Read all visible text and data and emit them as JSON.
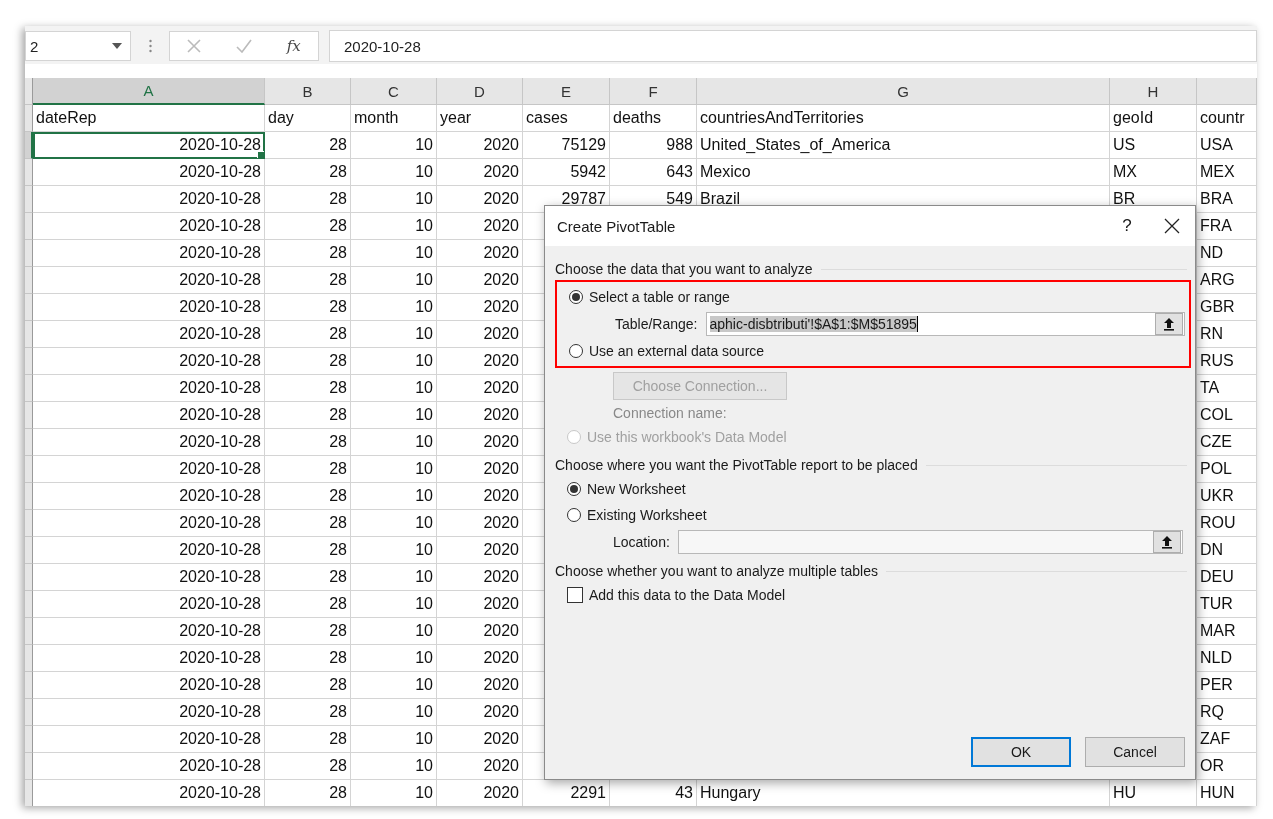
{
  "formula_bar": {
    "name_box": "2",
    "fx": "fx",
    "formula": "2020-10-28"
  },
  "sheet": {
    "columns": [
      {
        "label": "A",
        "selected": true
      },
      {
        "label": "B",
        "selected": false
      },
      {
        "label": "C",
        "selected": false
      },
      {
        "label": "D",
        "selected": false
      },
      {
        "label": "E",
        "selected": false
      },
      {
        "label": "F",
        "selected": false
      },
      {
        "label": "G",
        "selected": false
      },
      {
        "label": "H",
        "selected": false
      },
      {
        "selected": false
      }
    ],
    "rows": [
      {
        "kind": "header",
        "selected": false,
        "cells": {
          "A": "dateRep",
          "B": "day",
          "C": "month",
          "D": "year",
          "E": "cases",
          "F": "deaths",
          "G": "countriesAndTerritories",
          "H": "geoId",
          "I": "countr"
        }
      },
      {
        "kind": "data",
        "selected": true,
        "cells": {
          "A": "2020-10-28",
          "B": "28",
          "C": "10",
          "D": "2020",
          "E": "75129",
          "F": "988",
          "G": "United_States_of_America",
          "H": "US",
          "I": "USA"
        }
      },
      {
        "kind": "data",
        "selected": false,
        "cells": {
          "A": "2020-10-28",
          "B": "28",
          "C": "10",
          "D": "2020",
          "E": "5942",
          "F": "643",
          "G": "Mexico",
          "H": "MX",
          "I": "MEX"
        }
      },
      {
        "kind": "data",
        "selected": false,
        "cells": {
          "A": "2020-10-28",
          "B": "28",
          "C": "10",
          "D": "2020",
          "E": "29787",
          "F": "549",
          "G": "Brazil",
          "H": "BR",
          "I": "BRA"
        }
      },
      {
        "kind": "data",
        "selected": false,
        "cells": {
          "A": "2020-10-28",
          "B": "28",
          "C": "10",
          "D": "2020",
          "I": "FRA"
        }
      },
      {
        "kind": "data",
        "selected": false,
        "cells": {
          "A": "2020-10-28",
          "B": "28",
          "C": "10",
          "D": "2020",
          "I": "ND"
        }
      },
      {
        "kind": "data",
        "selected": false,
        "cells": {
          "A": "2020-10-28",
          "B": "28",
          "C": "10",
          "D": "2020",
          "I": "ARG"
        }
      },
      {
        "kind": "data",
        "selected": false,
        "cells": {
          "A": "2020-10-28",
          "B": "28",
          "C": "10",
          "D": "2020",
          "I": "GBR"
        }
      },
      {
        "kind": "data",
        "selected": false,
        "cells": {
          "A": "2020-10-28",
          "B": "28",
          "C": "10",
          "D": "2020",
          "I": "RN"
        }
      },
      {
        "kind": "data",
        "selected": false,
        "cells": {
          "A": "2020-10-28",
          "B": "28",
          "C": "10",
          "D": "2020",
          "I": "RUS"
        }
      },
      {
        "kind": "data",
        "selected": false,
        "cells": {
          "A": "2020-10-28",
          "B": "28",
          "C": "10",
          "D": "2020",
          "I": "TA"
        }
      },
      {
        "kind": "data",
        "selected": false,
        "cells": {
          "A": "2020-10-28",
          "B": "28",
          "C": "10",
          "D": "2020",
          "I": "COL"
        }
      },
      {
        "kind": "data",
        "selected": false,
        "cells": {
          "A": "2020-10-28",
          "B": "28",
          "C": "10",
          "D": "2020",
          "I": "CZE"
        }
      },
      {
        "kind": "data",
        "selected": false,
        "cells": {
          "A": "2020-10-28",
          "B": "28",
          "C": "10",
          "D": "2020",
          "I": "POL"
        }
      },
      {
        "kind": "data",
        "selected": false,
        "cells": {
          "A": "2020-10-28",
          "B": "28",
          "C": "10",
          "D": "2020",
          "I": "UKR"
        }
      },
      {
        "kind": "data",
        "selected": false,
        "cells": {
          "A": "2020-10-28",
          "B": "28",
          "C": "10",
          "D": "2020",
          "I": "ROU"
        }
      },
      {
        "kind": "data",
        "selected": false,
        "cells": {
          "A": "2020-10-28",
          "B": "28",
          "C": "10",
          "D": "2020",
          "I": "DN"
        }
      },
      {
        "kind": "data",
        "selected": false,
        "cells": {
          "A": "2020-10-28",
          "B": "28",
          "C": "10",
          "D": "2020",
          "I": "DEU"
        }
      },
      {
        "kind": "data",
        "selected": false,
        "cells": {
          "A": "2020-10-28",
          "B": "28",
          "C": "10",
          "D": "2020",
          "I": "TUR"
        }
      },
      {
        "kind": "data",
        "selected": false,
        "cells": {
          "A": "2020-10-28",
          "B": "28",
          "C": "10",
          "D": "2020",
          "I": "MAR"
        }
      },
      {
        "kind": "data",
        "selected": false,
        "cells": {
          "A": "2020-10-28",
          "B": "28",
          "C": "10",
          "D": "2020",
          "I": "NLD"
        }
      },
      {
        "kind": "data",
        "selected": false,
        "cells": {
          "A": "2020-10-28",
          "B": "28",
          "C": "10",
          "D": "2020",
          "I": "PER"
        }
      },
      {
        "kind": "data",
        "selected": false,
        "cells": {
          "A": "2020-10-28",
          "B": "28",
          "C": "10",
          "D": "2020",
          "I": "RQ"
        }
      },
      {
        "kind": "data",
        "selected": false,
        "cells": {
          "A": "2020-10-28",
          "B": "28",
          "C": "10",
          "D": "2020",
          "I": "ZAF"
        }
      },
      {
        "kind": "data",
        "selected": false,
        "cells": {
          "A": "2020-10-28",
          "B": "28",
          "C": "10",
          "D": "2020",
          "I": "OR"
        }
      },
      {
        "kind": "data",
        "selected": false,
        "cells": {
          "A": "2020-10-28",
          "B": "28",
          "C": "10",
          "D": "2020",
          "E": "2291",
          "F": "43",
          "G": "Hungary",
          "H": "HU",
          "I": "HUN"
        }
      }
    ]
  },
  "dialog": {
    "title": "Create PivotTable",
    "help": "?",
    "sections": [
      {
        "title": "Choose the data that you want to analyze",
        "items": [
          {
            "kind": "group",
            "highlighted": true,
            "items": [
              {
                "kind": "radio",
                "label": "Select a table or range",
                "selected": true,
                "disabled": false
              },
              {
                "kind": "field",
                "label": "Table/Range:",
                "value": "aphic-disbtributi'!$A$1:$M$51895",
                "text_selected": true
              },
              {
                "kind": "radio",
                "label": "Use an external data source",
                "selected": false,
                "disabled": false
              }
            ]
          },
          {
            "kind": "button",
            "label": "Choose Connection...",
            "disabled": true
          },
          {
            "kind": "label",
            "label": "Connection name:",
            "disabled": true
          },
          {
            "kind": "radio",
            "label": "Use this workbook's Data Model",
            "selected": false,
            "disabled": true
          }
        ]
      },
      {
        "title": "Choose where you want the PivotTable report to be placed",
        "items": [
          {
            "kind": "radio",
            "label": "New Worksheet",
            "selected": true,
            "disabled": false
          },
          {
            "kind": "radio",
            "label": "Existing Worksheet",
            "selected": false,
            "disabled": false
          },
          {
            "kind": "field",
            "label": "Location:",
            "disabled": true
          }
        ]
      },
      {
        "title": "Choose whether you want to analyze multiple tables",
        "items": [
          {
            "kind": "checkbox",
            "label": "Add this data to the Data Model",
            "checked": false
          }
        ]
      }
    ],
    "buttons": [
      {
        "label": "OK",
        "default": true
      },
      {
        "label": "Cancel",
        "default": false
      }
    ]
  }
}
